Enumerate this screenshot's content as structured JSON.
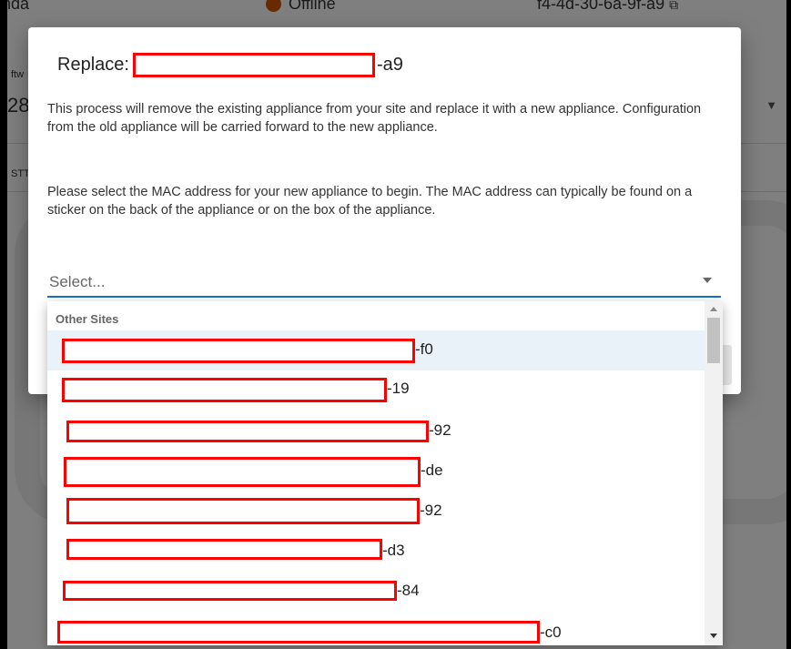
{
  "background": {
    "device_name": "nda",
    "status": "Offline",
    "mac_text": "f4-4d-30-6a-9f-a9",
    "label_small": "ftw",
    "value_28": "28",
    "label_stt": "STT"
  },
  "modal": {
    "title_prefix": "Replace:",
    "title_suffix": "-a9",
    "paragraph1": "This process will remove the existing appliance from your site and replace it with a new appliance. Configuration from the old appliance will be carried forward to the new appliance.",
    "paragraph2": "Please select the MAC address for your new appliance to begin. The MAC address can typically be found on a sticker on the back of the appliance or on the box of the appliance.",
    "select_placeholder": "Select..."
  },
  "dropdown": {
    "group_label": "Other Sites",
    "options": [
      {
        "suffix": "-f0"
      },
      {
        "suffix": "-19"
      },
      {
        "suffix": "-92"
      },
      {
        "suffix": "-de"
      },
      {
        "suffix": "-92"
      },
      {
        "suffix": "-d3"
      },
      {
        "suffix": "-84"
      },
      {
        "suffix": "-c0"
      }
    ]
  },
  "colors": {
    "accent": "#1a73b8",
    "redaction": "#ff0000",
    "status_offline": "#d35400"
  },
  "icons": [
    "offline-status-icon",
    "copy-icon",
    "chevron-down-icon",
    "scroll-up-icon",
    "scroll-down-icon"
  ]
}
